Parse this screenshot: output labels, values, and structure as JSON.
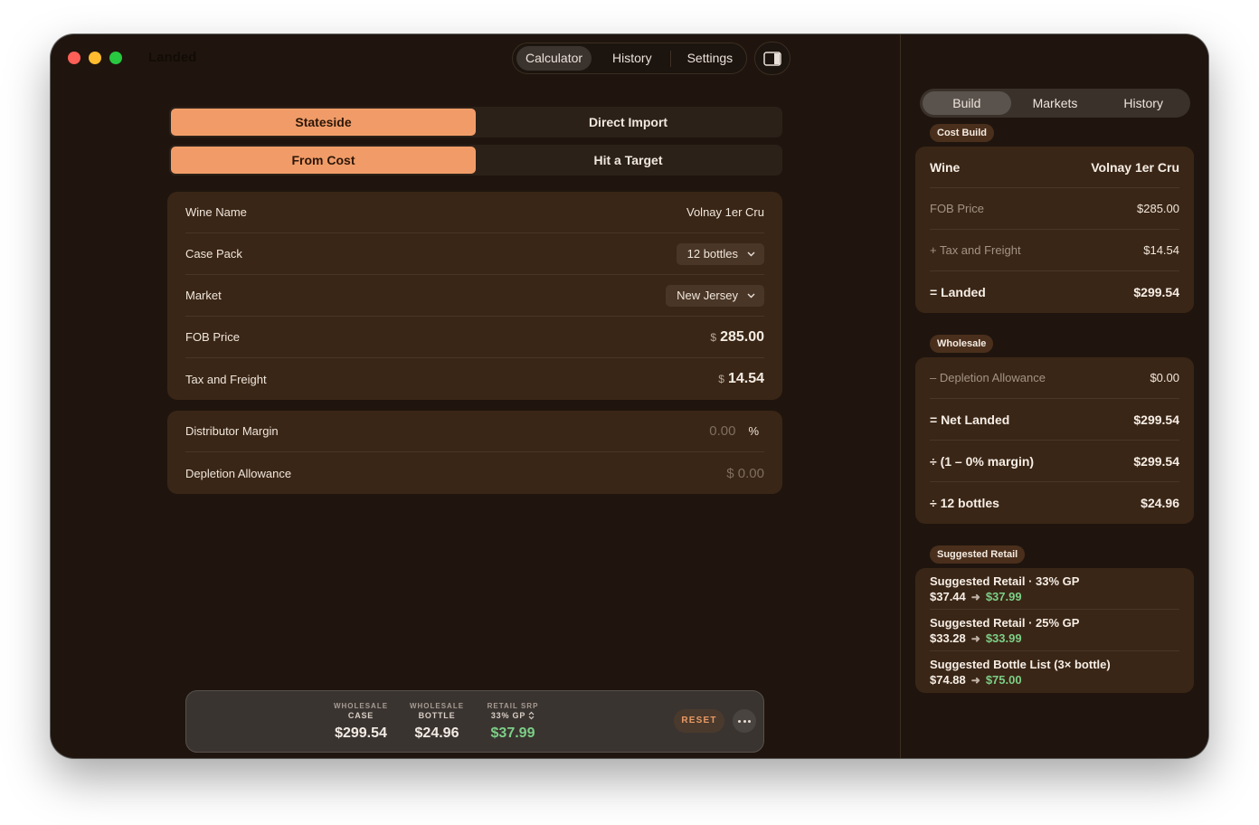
{
  "app": {
    "title": "Landed"
  },
  "top_tabs": [
    "Calculator",
    "History",
    "Settings"
  ],
  "mode": {
    "options": [
      "Stateside",
      "Direct Import"
    ],
    "selected": "Stateside"
  },
  "direction": {
    "options": [
      "From Cost",
      "Hit a Target"
    ],
    "selected": "From Cost"
  },
  "inputs": {
    "wine_name": {
      "label": "Wine Name",
      "value": "Volnay 1er Cru"
    },
    "case_pack": {
      "label": "Case Pack",
      "value": "12 bottles"
    },
    "market": {
      "label": "Market",
      "value": "New Jersey"
    },
    "fob_price": {
      "label": "FOB Price",
      "currency": "$",
      "value": "285.00"
    },
    "tax_freight": {
      "label": "Tax and Freight",
      "currency": "$",
      "value": "14.54"
    }
  },
  "adjustments": {
    "distributor_margin": {
      "label": "Distributor Margin",
      "value": "0.00",
      "unit": "%"
    },
    "depletion_allowance": {
      "label": "Depletion Allowance",
      "value": "$ 0.00"
    }
  },
  "summary": {
    "wholesale_case": {
      "l1": "WHOLESALE",
      "l2": "CASE",
      "value": "$299.54"
    },
    "wholesale_bottle": {
      "l1": "WHOLESALE",
      "l2": "BOTTLE",
      "value": "$24.96"
    },
    "retail_srp": {
      "l1": "RETAIL SRP",
      "l2": "33% GP",
      "value": "$37.99"
    },
    "reset_label": "RESET"
  },
  "right_tabs": [
    "Build",
    "Markets",
    "History"
  ],
  "cost_build": {
    "pill": "Cost Build",
    "rows": [
      {
        "label": "Wine",
        "value": "Volnay 1er Cru"
      },
      {
        "label": "FOB Price",
        "value": "$285.00"
      },
      {
        "label": "+ Tax and Freight",
        "value": "$14.54"
      },
      {
        "label": "= Landed",
        "value": "$299.54"
      }
    ]
  },
  "wholesale": {
    "pill": "Wholesale",
    "rows": [
      {
        "label": "– Depletion Allowance",
        "value": "$0.00"
      },
      {
        "label": "= Net Landed",
        "value": "$299.54"
      },
      {
        "label": "÷ (1 – 0% margin)",
        "value": "$299.54"
      },
      {
        "label": "÷ 12 bottles",
        "value": "$24.96"
      }
    ]
  },
  "suggested_retail": {
    "pill": "Suggested Retail",
    "items": [
      {
        "title": "Suggested Retail · 33% GP",
        "from": "$37.44",
        "to": "$37.99"
      },
      {
        "title": "Suggested Retail · 25% GP",
        "from": "$33.28",
        "to": "$33.99"
      },
      {
        "title": "Suggested Bottle List (3× bottle)",
        "from": "$74.88",
        "to": "$75.00"
      }
    ]
  },
  "colors": {
    "accent": "#f19c68",
    "positive": "#7ccf86",
    "background": "#1f150e",
    "card": "#3a2616"
  }
}
